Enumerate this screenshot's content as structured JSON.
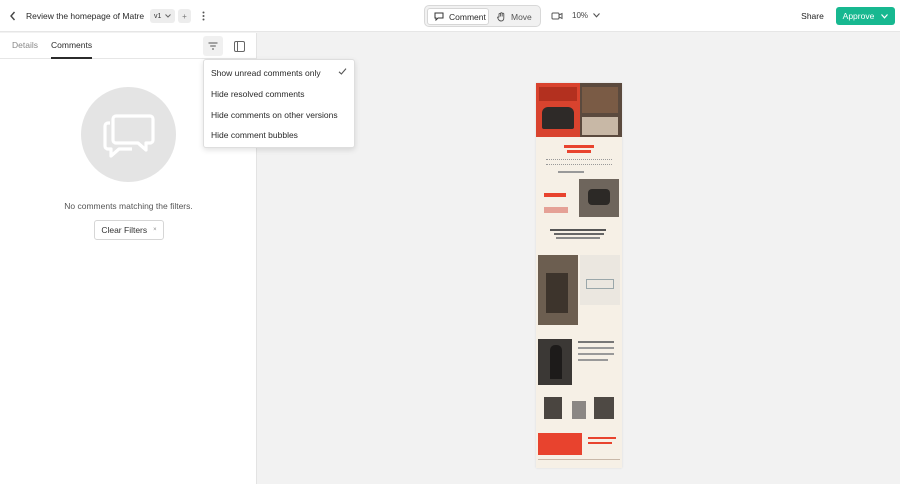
{
  "header": {
    "back_icon": "chevron-left-icon",
    "title": "Review the homepage of Matre",
    "version_label": "v1",
    "add_version_label": "+",
    "more_icon": "kebab-icon",
    "modes": {
      "comment_label": "Comment",
      "move_label": "Move"
    },
    "present_icon": "present-icon",
    "zoom_label": "10%",
    "share_label": "Share",
    "approve_label": "Approve"
  },
  "sidebar": {
    "tabs": [
      {
        "label": "Details",
        "active": false
      },
      {
        "label": "Comments",
        "active": true
      }
    ],
    "empty_state": {
      "icon": "chat-bubbles-icon",
      "message": "No comments matching the filters."
    },
    "clear_filters_label": "Clear Filters",
    "clear_filters_x": "×"
  },
  "filter_menu": {
    "items": [
      {
        "label": "Show unread comments only",
        "checked": true
      },
      {
        "label": "Hide resolved comments",
        "checked": false
      },
      {
        "label": "Hide comments on other versions",
        "checked": false
      },
      {
        "label": "Hide comment bubbles",
        "checked": false
      }
    ]
  },
  "colors": {
    "approve": "#17b890",
    "accent_red": "#e8432e",
    "panel": "#ffffff",
    "canvas": "#f2f2f2"
  }
}
